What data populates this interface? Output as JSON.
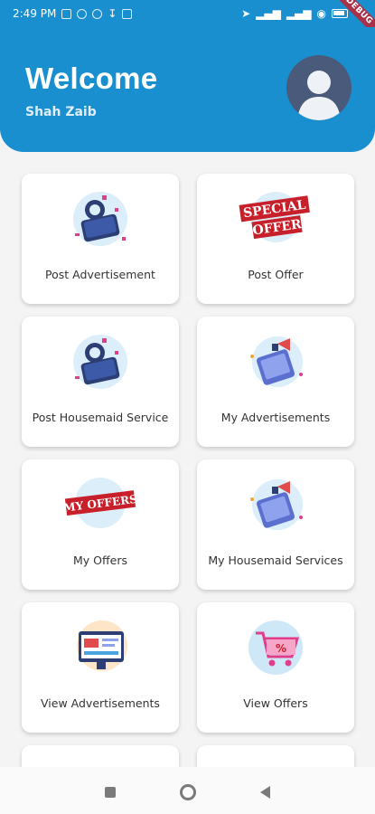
{
  "status_bar": {
    "time": "2:49 PM",
    "battery_label": "",
    "debug": "DEBUG"
  },
  "header": {
    "title": "Welcome",
    "subtitle": "Shah Zaib",
    "avatar_icon": "user-avatar-icon",
    "background": "#1a8fd0"
  },
  "cards": [
    {
      "label": "Post Advertisement",
      "icon": "phone-megaphone-icon"
    },
    {
      "label": "Post Offer",
      "icon": "special-offer-stamp-icon"
    },
    {
      "label": "Post Housemaid Service",
      "icon": "phone-megaphone-icon"
    },
    {
      "label": "My Advertisements",
      "icon": "phone-promo-icon"
    },
    {
      "label": "My Offers",
      "icon": "my-offers-stamp-icon"
    },
    {
      "label": "My Housemaid Services",
      "icon": "phone-promo-icon"
    },
    {
      "label": "View Advertisements",
      "icon": "web-ads-icon"
    },
    {
      "label": "View Offers",
      "icon": "shopping-cart-percent-icon"
    }
  ],
  "stamps": {
    "special_1": "SPECIAL",
    "special_2": "OFFER",
    "my_offers": "MY OFFERS"
  },
  "colors": {
    "accent": "#1a8fd0",
    "stamp_red": "#c8202a"
  }
}
